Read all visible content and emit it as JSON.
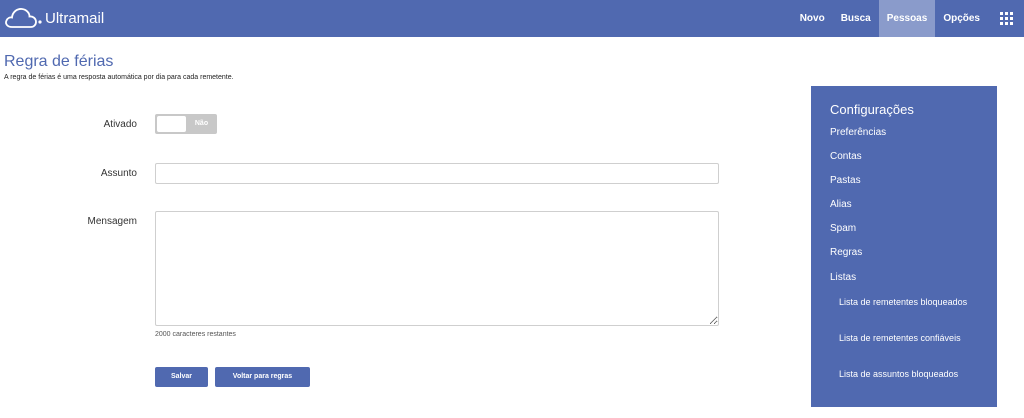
{
  "app": {
    "name": "Ultramail"
  },
  "nav": {
    "items": [
      {
        "label": "Novo",
        "active": false
      },
      {
        "label": "Busca",
        "active": false
      },
      {
        "label": "Pessoas",
        "active": true
      },
      {
        "label": "Opções",
        "active": false
      }
    ],
    "apps_icon": "grid-icon"
  },
  "page": {
    "title": "Regra de férias",
    "subtitle": "A regra de férias é uma resposta automática por dia para cada remetente."
  },
  "form": {
    "enabled_label": "Ativado",
    "toggle_state": "Não",
    "subject_label": "Assunto",
    "subject_value": "",
    "message_label": "Mensagem",
    "message_value": "",
    "chars_remaining": "2000 caracteres restantes",
    "save_label": "Salvar",
    "back_label": "Voltar para regras"
  },
  "sidebar": {
    "title": "Configurações",
    "items": [
      {
        "label": "Preferências"
      },
      {
        "label": "Contas"
      },
      {
        "label": "Pastas"
      },
      {
        "label": "Alias"
      },
      {
        "label": "Spam"
      },
      {
        "label": "Regras"
      },
      {
        "label": "Listas"
      }
    ],
    "subitems": [
      {
        "label": "Lista de remetentes bloqueados"
      },
      {
        "label": "Lista de remetentes confiáveis"
      },
      {
        "label": "Lista de assuntos bloqueados"
      }
    ]
  },
  "colors": {
    "brand": "#5069b0",
    "nav_active": "#8a9bcb"
  }
}
